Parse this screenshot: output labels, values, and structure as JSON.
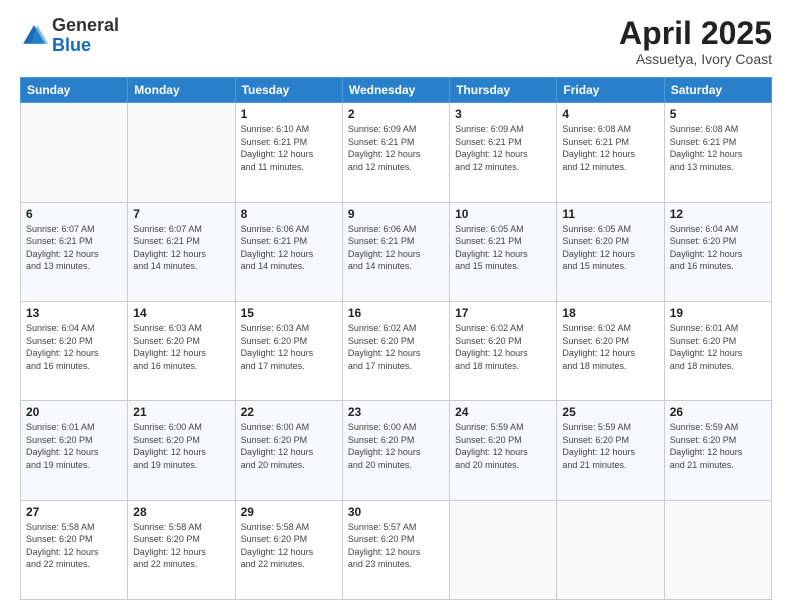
{
  "logo": {
    "general": "General",
    "blue": "Blue"
  },
  "header": {
    "month": "April 2025",
    "location": "Assuetya, Ivory Coast"
  },
  "weekdays": [
    "Sunday",
    "Monday",
    "Tuesday",
    "Wednesday",
    "Thursday",
    "Friday",
    "Saturday"
  ],
  "weeks": [
    [
      {
        "day": null,
        "info": null
      },
      {
        "day": null,
        "info": null
      },
      {
        "day": "1",
        "info": "Sunrise: 6:10 AM\nSunset: 6:21 PM\nDaylight: 12 hours\nand 11 minutes."
      },
      {
        "day": "2",
        "info": "Sunrise: 6:09 AM\nSunset: 6:21 PM\nDaylight: 12 hours\nand 12 minutes."
      },
      {
        "day": "3",
        "info": "Sunrise: 6:09 AM\nSunset: 6:21 PM\nDaylight: 12 hours\nand 12 minutes."
      },
      {
        "day": "4",
        "info": "Sunrise: 6:08 AM\nSunset: 6:21 PM\nDaylight: 12 hours\nand 12 minutes."
      },
      {
        "day": "5",
        "info": "Sunrise: 6:08 AM\nSunset: 6:21 PM\nDaylight: 12 hours\nand 13 minutes."
      }
    ],
    [
      {
        "day": "6",
        "info": "Sunrise: 6:07 AM\nSunset: 6:21 PM\nDaylight: 12 hours\nand 13 minutes."
      },
      {
        "day": "7",
        "info": "Sunrise: 6:07 AM\nSunset: 6:21 PM\nDaylight: 12 hours\nand 14 minutes."
      },
      {
        "day": "8",
        "info": "Sunrise: 6:06 AM\nSunset: 6:21 PM\nDaylight: 12 hours\nand 14 minutes."
      },
      {
        "day": "9",
        "info": "Sunrise: 6:06 AM\nSunset: 6:21 PM\nDaylight: 12 hours\nand 14 minutes."
      },
      {
        "day": "10",
        "info": "Sunrise: 6:05 AM\nSunset: 6:21 PM\nDaylight: 12 hours\nand 15 minutes."
      },
      {
        "day": "11",
        "info": "Sunrise: 6:05 AM\nSunset: 6:20 PM\nDaylight: 12 hours\nand 15 minutes."
      },
      {
        "day": "12",
        "info": "Sunrise: 6:04 AM\nSunset: 6:20 PM\nDaylight: 12 hours\nand 16 minutes."
      }
    ],
    [
      {
        "day": "13",
        "info": "Sunrise: 6:04 AM\nSunset: 6:20 PM\nDaylight: 12 hours\nand 16 minutes."
      },
      {
        "day": "14",
        "info": "Sunrise: 6:03 AM\nSunset: 6:20 PM\nDaylight: 12 hours\nand 16 minutes."
      },
      {
        "day": "15",
        "info": "Sunrise: 6:03 AM\nSunset: 6:20 PM\nDaylight: 12 hours\nand 17 minutes."
      },
      {
        "day": "16",
        "info": "Sunrise: 6:02 AM\nSunset: 6:20 PM\nDaylight: 12 hours\nand 17 minutes."
      },
      {
        "day": "17",
        "info": "Sunrise: 6:02 AM\nSunset: 6:20 PM\nDaylight: 12 hours\nand 18 minutes."
      },
      {
        "day": "18",
        "info": "Sunrise: 6:02 AM\nSunset: 6:20 PM\nDaylight: 12 hours\nand 18 minutes."
      },
      {
        "day": "19",
        "info": "Sunrise: 6:01 AM\nSunset: 6:20 PM\nDaylight: 12 hours\nand 18 minutes."
      }
    ],
    [
      {
        "day": "20",
        "info": "Sunrise: 6:01 AM\nSunset: 6:20 PM\nDaylight: 12 hours\nand 19 minutes."
      },
      {
        "day": "21",
        "info": "Sunrise: 6:00 AM\nSunset: 6:20 PM\nDaylight: 12 hours\nand 19 minutes."
      },
      {
        "day": "22",
        "info": "Sunrise: 6:00 AM\nSunset: 6:20 PM\nDaylight: 12 hours\nand 20 minutes."
      },
      {
        "day": "23",
        "info": "Sunrise: 6:00 AM\nSunset: 6:20 PM\nDaylight: 12 hours\nand 20 minutes."
      },
      {
        "day": "24",
        "info": "Sunrise: 5:59 AM\nSunset: 6:20 PM\nDaylight: 12 hours\nand 20 minutes."
      },
      {
        "day": "25",
        "info": "Sunrise: 5:59 AM\nSunset: 6:20 PM\nDaylight: 12 hours\nand 21 minutes."
      },
      {
        "day": "26",
        "info": "Sunrise: 5:59 AM\nSunset: 6:20 PM\nDaylight: 12 hours\nand 21 minutes."
      }
    ],
    [
      {
        "day": "27",
        "info": "Sunrise: 5:58 AM\nSunset: 6:20 PM\nDaylight: 12 hours\nand 22 minutes."
      },
      {
        "day": "28",
        "info": "Sunrise: 5:58 AM\nSunset: 6:20 PM\nDaylight: 12 hours\nand 22 minutes."
      },
      {
        "day": "29",
        "info": "Sunrise: 5:58 AM\nSunset: 6:20 PM\nDaylight: 12 hours\nand 22 minutes."
      },
      {
        "day": "30",
        "info": "Sunrise: 5:57 AM\nSunset: 6:20 PM\nDaylight: 12 hours\nand 23 minutes."
      },
      {
        "day": null,
        "info": null
      },
      {
        "day": null,
        "info": null
      },
      {
        "day": null,
        "info": null
      }
    ]
  ]
}
